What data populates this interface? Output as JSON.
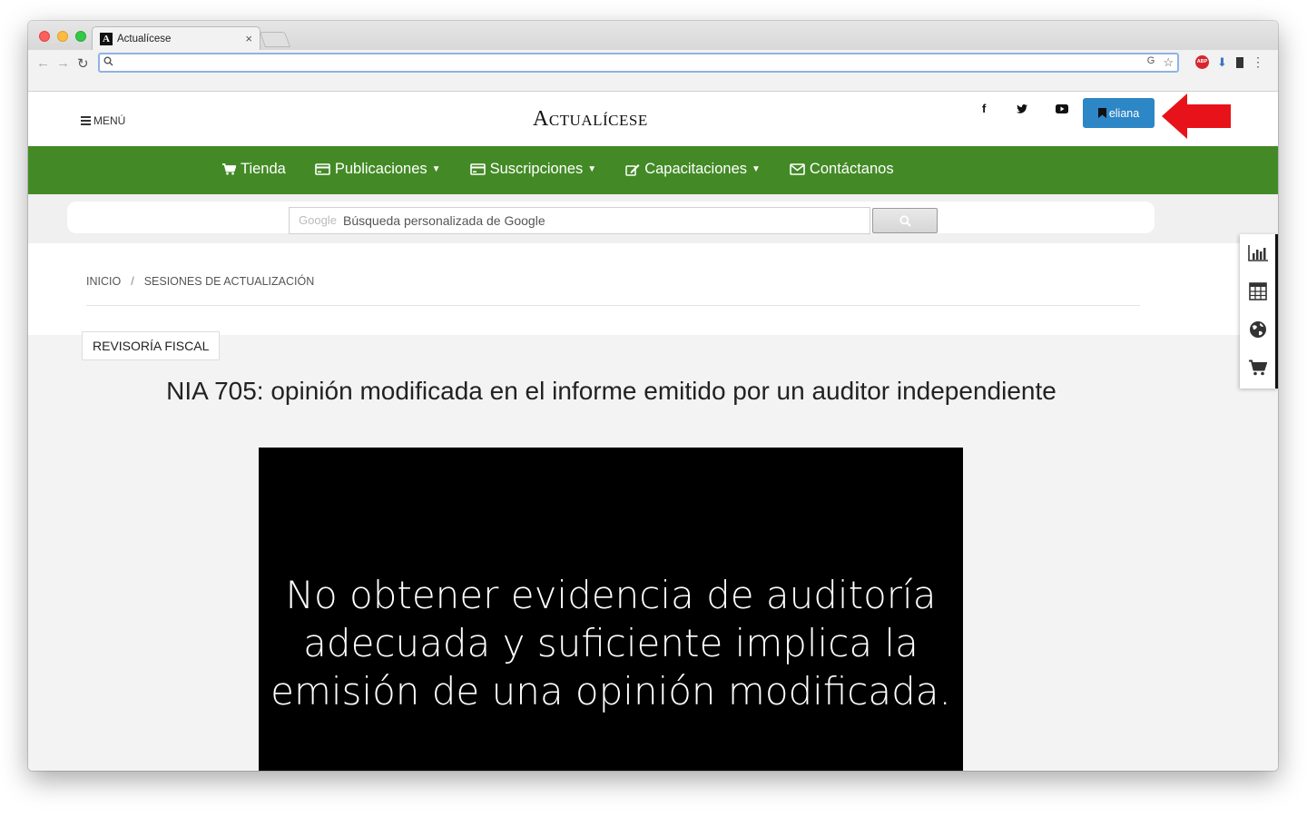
{
  "browser": {
    "tab_title": "Actualícese",
    "tab_favicon": "A",
    "tab_close": "×",
    "address_value": ""
  },
  "header": {
    "menu_label": "MENÚ",
    "logo": "Actualícese",
    "social_icons": [
      "facebook-icon",
      "twitter-icon",
      "youtube-icon"
    ],
    "user_label": "eliana",
    "accent_color": "#2d86c6",
    "arrow_color": "#e8131a"
  },
  "nav": {
    "background": "#438a26",
    "items": [
      {
        "label": "Tienda",
        "icon": "cart-icon",
        "dropdown": false
      },
      {
        "label": "Publicaciones",
        "icon": "card-icon",
        "dropdown": true
      },
      {
        "label": "Suscripciones",
        "icon": "card-icon",
        "dropdown": true
      },
      {
        "label": "Capacitaciones",
        "icon": "edit-icon",
        "dropdown": true
      },
      {
        "label": "Contáctanos",
        "icon": "envelope-icon",
        "dropdown": false
      }
    ]
  },
  "search": {
    "brand": "Google",
    "placeholder": "Búsqueda personalizada de Google"
  },
  "breadcrumb": {
    "home": "INICIO",
    "separator": "/",
    "current": "SESIONES DE ACTUALIZACIÓN"
  },
  "article": {
    "category": "REVISORÍA FISCAL",
    "title": "NIA 705: opinión modificada en el informe emitido por un auditor independiente",
    "video_caption_lines": [
      "No obtener evidencia de auditoría",
      "adecuada y suficiente implica la",
      "emisión de una opinión modificada."
    ]
  },
  "side_panel": {
    "icons": [
      "bar-chart-icon",
      "calculator-icon",
      "globe-icon",
      "cart-icon"
    ]
  }
}
